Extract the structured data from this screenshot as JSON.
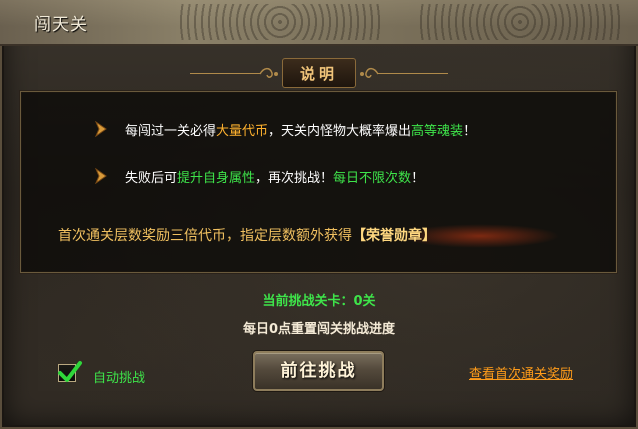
{
  "window": {
    "title": "闯天关"
  },
  "info": {
    "header": "说明",
    "rows": [
      {
        "t1": "每闯过一关必得",
        "hl1": "大量代币",
        "t2": "，天关内怪物大概率爆出",
        "hl2": "高等魂装",
        "t3": "！"
      },
      {
        "t1": "失败后可",
        "hl1": "提升自身属性",
        "t2": "，再次挑战！",
        "hl2": "每日不限次数",
        "t3": "！"
      }
    ],
    "reward_text": "首次通关层数奖励三倍代币，指定层数额外获得",
    "reward_medal": "【荣誉勋章】"
  },
  "status": {
    "current_level": "当前挑战关卡：0关",
    "reset_note": "每日0点重置闯关挑战进度"
  },
  "controls": {
    "auto_challenge_label": "自动挑战",
    "auto_challenge_checked": true,
    "go_button_label": "前往挑战",
    "view_rewards_link": "查看首次通关奖励"
  },
  "colors": {
    "highlight_orange": "#ffb22e",
    "highlight_green": "#3ee44a",
    "link_orange": "#ff9c1a",
    "header_gold": "#f0c47a"
  }
}
